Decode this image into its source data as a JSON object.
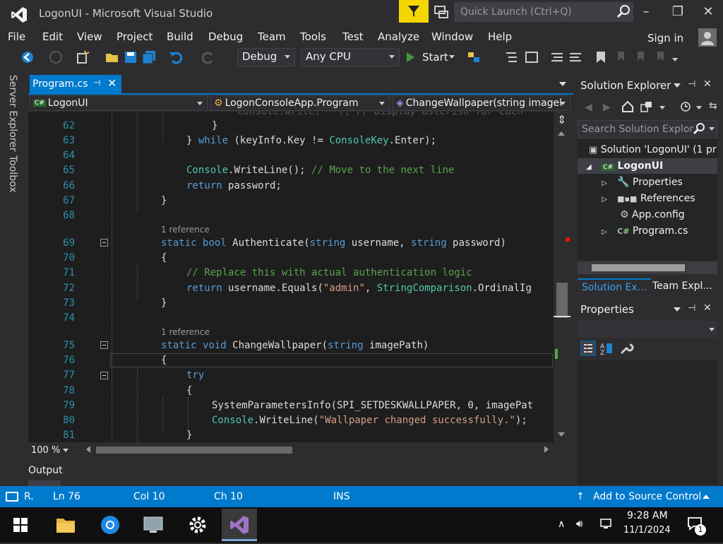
{
  "window": {
    "title": "LogonUI - Microsoft Visual Studio",
    "quick_launch_placeholder": "Quick Launch (Ctrl+Q)",
    "minimize": "–",
    "restore": "❐",
    "close": "✕"
  },
  "menu": {
    "items": [
      "File",
      "Edit",
      "View",
      "Project",
      "Build",
      "Debug",
      "Team",
      "Tools",
      "Test",
      "Analyze",
      "Window",
      "Help"
    ],
    "sign_in": "Sign in"
  },
  "toolbar": {
    "configuration": "Debug",
    "platform": "Any CPU",
    "start_label": "Start"
  },
  "left_rail": {
    "server_explorer": "Server Explorer",
    "toolbox": "Toolbox"
  },
  "editor_tab": {
    "label": "Program.cs",
    "pin": "⊣",
    "close": "✕"
  },
  "nav_bar": {
    "project": "LogonUI",
    "type": "LogonConsoleApp.Program",
    "member": "ChangeWallpaper(string imagel"
  },
  "code": {
    "lines": [
      {
        "n": "62",
        "text": "}"
      },
      {
        "n": "63",
        "text": "} while (keyInfo.Key != ConsoleKey.Enter);"
      },
      {
        "n": "64",
        "text": ""
      },
      {
        "n": "65",
        "text": "Console.WriteLine(); // Move to the next line"
      },
      {
        "n": "66",
        "text": "return password;"
      },
      {
        "n": "67",
        "text": "}"
      },
      {
        "n": "68",
        "text": ""
      },
      {
        "n": "69",
        "text": "static bool Authenticate(string username, string password)"
      },
      {
        "n": "70",
        "text": "{"
      },
      {
        "n": "71",
        "text": "// Replace this with actual authentication logic"
      },
      {
        "n": "72",
        "text": "return username.Equals(\"admin\", StringComparison.OrdinalIg"
      },
      {
        "n": "73",
        "text": "}"
      },
      {
        "n": "74",
        "text": ""
      },
      {
        "n": "75",
        "text": "static void ChangeWallpaper(string imagePath)"
      },
      {
        "n": "76",
        "text": "{"
      },
      {
        "n": "77",
        "text": "try"
      },
      {
        "n": "78",
        "text": "{"
      },
      {
        "n": "79",
        "text": "SystemParametersInfo(SPI_SETDESKWALLPAPER, 0, imagePat"
      },
      {
        "n": "80",
        "text": "Console.WriteLine(\"Wallpaper changed successfully.\");"
      },
      {
        "n": "81",
        "text": "}"
      }
    ],
    "reference_label": "1 reference"
  },
  "editor_bottom": {
    "zoom": "100 %"
  },
  "output_panel": {
    "label": "Output"
  },
  "solution_explorer": {
    "title": "Solution Explorer",
    "search_placeholder": "Search Solution Explor",
    "tree": [
      {
        "label": "Solution 'LogonUI' (1 pr",
        "icon": "solution-icon"
      },
      {
        "label": "LogonUI",
        "icon": "csharp-project-icon",
        "selected": true
      },
      {
        "label": "Properties",
        "icon": "wrench-icon"
      },
      {
        "label": "References",
        "icon": "references-icon"
      },
      {
        "label": "App.config",
        "icon": "config-file-icon"
      },
      {
        "label": "Program.cs",
        "icon": "csharp-file-icon"
      }
    ],
    "tab_solution": "Solution Ex...",
    "tab_team": "Team Expl..."
  },
  "properties": {
    "title": "Properties"
  },
  "status_bar": {
    "ready": "R.",
    "ln": "Ln 76",
    "col": "Col 10",
    "ch": "Ch 10",
    "mode": "INS",
    "source_control": "Add to Source Control"
  },
  "taskbar": {
    "time": "9:28 AM",
    "date": "11/1/2024",
    "notification_count": "1"
  },
  "colors": {
    "accent": "#007acc",
    "filter_yellow": "#f4d600"
  }
}
